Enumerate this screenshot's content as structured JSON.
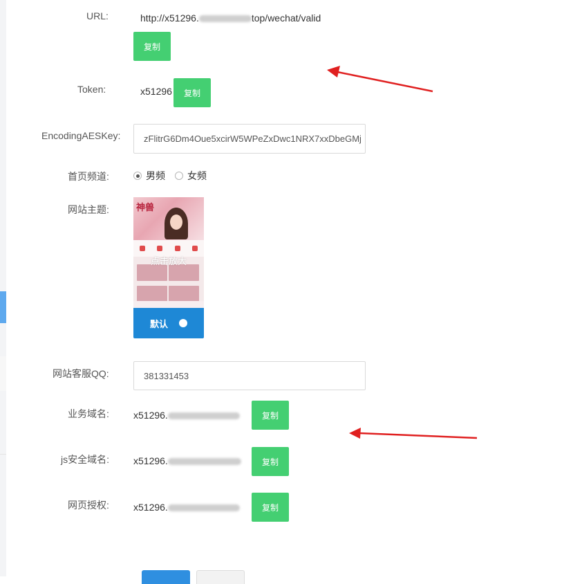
{
  "form": {
    "url": {
      "label": "URL:",
      "value_prefix": "http://x51296.",
      "value_suffix": "top/wechat/valid",
      "copy_label": "复制"
    },
    "token": {
      "label": "Token:",
      "value": "x51296",
      "copy_label": "复制"
    },
    "aes": {
      "label": "EncodingAESKey:",
      "value": "zFlitrG6Dm4Oue5xcirW5WPeZxDwc1NRX7xxDbeGMj"
    },
    "channel": {
      "label": "首页频道:",
      "options": [
        "男频",
        "女频"
      ],
      "selected": "男频"
    },
    "theme": {
      "label": "网站主题:",
      "thumb_title": "神兽",
      "overlay": "点击放大",
      "button_label": "默认"
    },
    "qq": {
      "label": "网站客服QQ:",
      "value": "381331453"
    },
    "biz_domain": {
      "label": "业务域名:",
      "value_prefix": "x51296.",
      "copy_label": "复制"
    },
    "js_domain": {
      "label": "js安全域名:",
      "value_prefix": "x51296.",
      "copy_label": "复制"
    },
    "auth_domain": {
      "label": "网页授权:",
      "value_prefix": "x51296.",
      "copy_label": "复制"
    }
  },
  "colors": {
    "copy_green": "#44cf72",
    "primary_blue": "#1e88d6",
    "arrow_red": "#e02020"
  }
}
